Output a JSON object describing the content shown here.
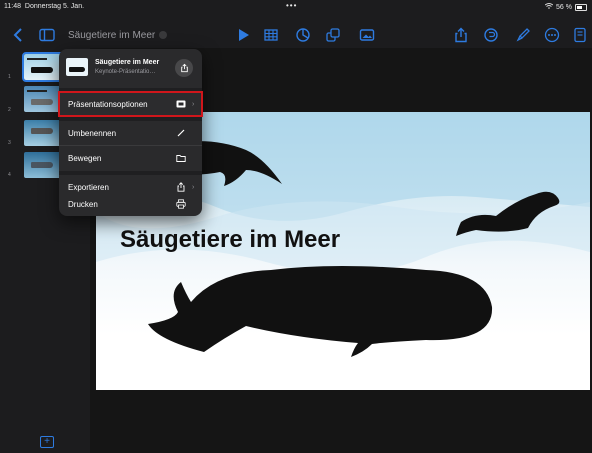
{
  "status": {
    "time": "11:48",
    "date": "Donnerstag 5. Jan.",
    "battery": "56 %"
  },
  "toolbar": {
    "doc_title": "Säugetiere im Meer"
  },
  "navigator": {
    "slide_numbers": [
      "1",
      "2",
      "3",
      "4"
    ]
  },
  "menu": {
    "doc_name": "Säugetiere im Meer",
    "doc_type": "Keynote-Präsentatio…",
    "items": [
      {
        "label": "Präsentationsoptionen",
        "icon": "slideshow-icon",
        "highlighted": true
      },
      {
        "label": "Umbenennen",
        "icon": "pencil-icon"
      },
      {
        "label": "Bewegen",
        "icon": "folder-icon"
      },
      {
        "label": "Exportieren",
        "icon": "export-icon"
      },
      {
        "label": "Drucken",
        "icon": "printer-icon"
      }
    ]
  },
  "slide": {
    "title": "Säugetiere im Meer"
  },
  "colors": {
    "accent": "#2e7be0",
    "highlight_border": "#d0161b",
    "menu_bg": "#2a2a2c"
  }
}
